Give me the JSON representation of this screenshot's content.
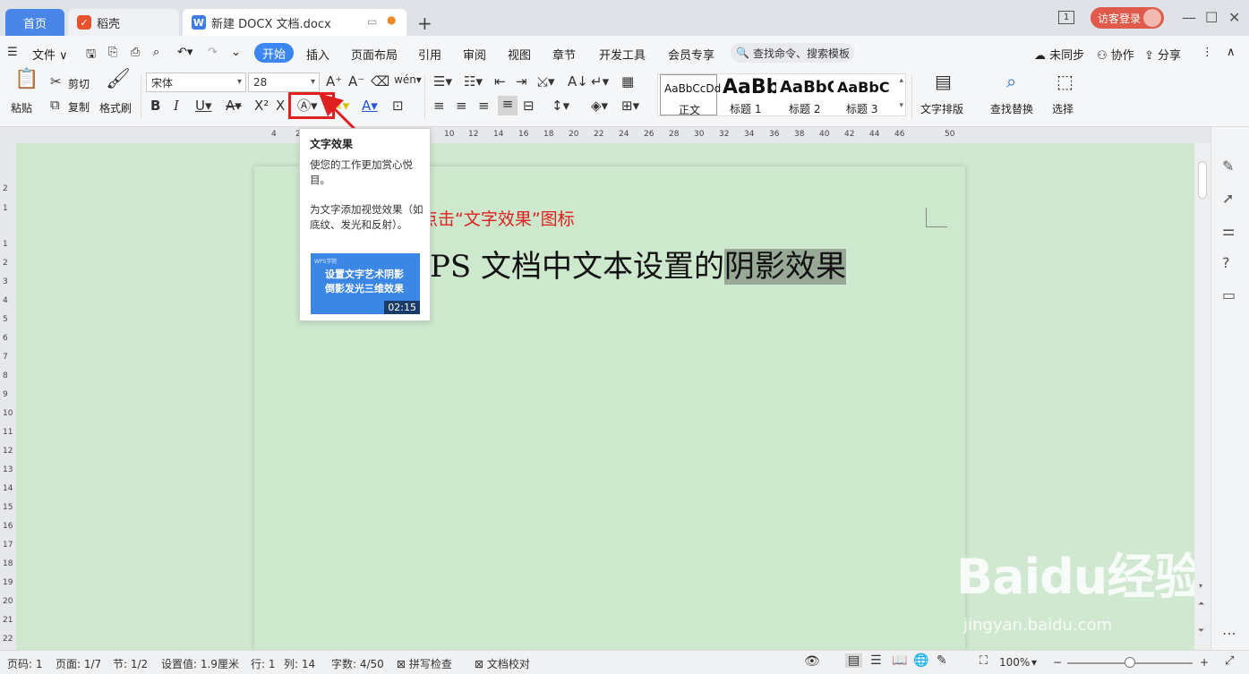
{
  "titlebar": {
    "tabs": [
      {
        "label": "首页"
      },
      {
        "label": "稻壳"
      },
      {
        "label": "新建 DOCX 文档.docx"
      }
    ],
    "window_badge": "1",
    "login_label": "访客登录"
  },
  "menubar": {
    "file_label": "文件",
    "items": [
      "开始",
      "插入",
      "页面布局",
      "引用",
      "审阅",
      "视图",
      "章节",
      "开发工具",
      "会员专享"
    ],
    "search_placeholder": "查找命令、搜索模板",
    "right_items": [
      "未同步",
      "协作",
      "分享"
    ]
  },
  "toolbar": {
    "paste": "粘贴",
    "cut": "剪切",
    "copy": "复制",
    "format_painter": "格式刷",
    "font_name": "宋体",
    "font_size": "28",
    "styles": [
      {
        "sample": "AaBbCcDd",
        "name": "正文"
      },
      {
        "sample": "AaBb",
        "name": "标题 1"
      },
      {
        "sample": "AaBbC",
        "name": "标题 2"
      },
      {
        "sample": "AaBbC",
        "name": "标题 3"
      }
    ],
    "text_layout": "文字排版",
    "find_replace": "查找替换",
    "select": "选择"
  },
  "ruler": {
    "h_labels": [
      "4",
      "2",
      "10",
      "12",
      "14",
      "16",
      "18",
      "20",
      "22",
      "24",
      "26",
      "28",
      "30",
      "32",
      "34",
      "36",
      "38",
      "40",
      "42",
      "44",
      "46",
      "50"
    ],
    "v_labels": [
      "2",
      "1",
      "1",
      "2",
      "3",
      "4",
      "5",
      "6",
      "7",
      "8",
      "9",
      "10",
      "11",
      "12",
      "13",
      "14",
      "15",
      "16",
      "17",
      "18",
      "19",
      "20",
      "21",
      "22"
    ]
  },
  "tooltip": {
    "title": "文字效果",
    "desc1": "使您的工作更加赏心悦目。",
    "desc2": "为文字添加视觉效果（如底纹、发光和反射）。",
    "thumb_brand": "WPS学院",
    "thumb_line1": "设置文字艺术阴影",
    "thumb_line2": "倒影发光三维效果",
    "thumb_time": "02:15"
  },
  "annotation": "点击“文字效果”图标",
  "document": {
    "title_plain": "PS 文档中文本设置的",
    "title_selected": "阴影效果"
  },
  "watermark": {
    "line1": "Baidu经验",
    "line2": "jingyan.baidu.com"
  },
  "statusbar": {
    "page_num": "页码: 1",
    "page": "页面: 1/7",
    "section": "节: 1/2",
    "setting": "设置值: 1.9厘米",
    "row": "行: 1",
    "col": "列: 14",
    "words": "字数: 4/50",
    "spell": "拼写检查",
    "proof": "文档校对",
    "zoom": "100%"
  }
}
